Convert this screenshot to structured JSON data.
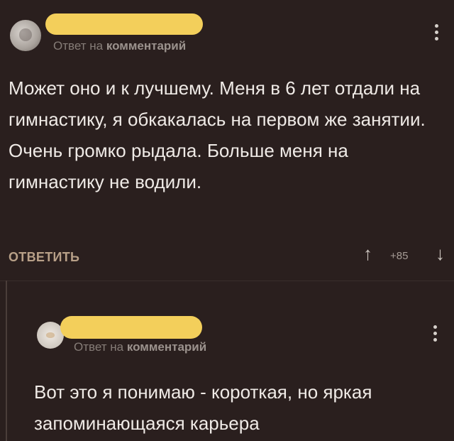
{
  "comment1": {
    "reply_prefix": "Ответ на",
    "reply_target": "комментарий",
    "text": "Может оно и к лучшему. Меня в 6 лет отдали на гимнастику, я обкакалась на первом же занятии. Очень громко рыдала. Больше меня на гимнастику не водили.",
    "reply_label": "ОТВЕТИТЬ",
    "score": "+85",
    "upvote_icon": "↑",
    "downvote_icon": "↓"
  },
  "comment2": {
    "reply_prefix": "Ответ на",
    "reply_target": "комментарий",
    "text": "Вот это я понимаю - короткая, но яркая запоминающаяся карьера"
  },
  "colors": {
    "background": "#2a1f1e",
    "redaction": "#f3cf5b",
    "reply_button": "#b8a088"
  }
}
